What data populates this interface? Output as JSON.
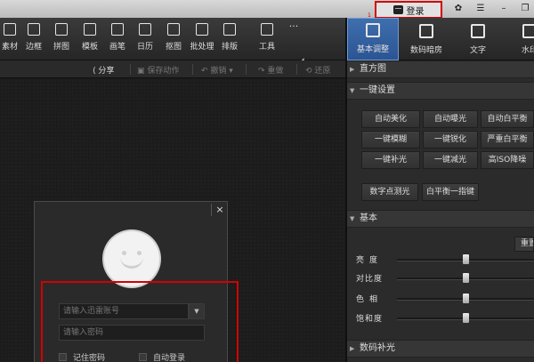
{
  "titlebar": {
    "login_label": "登录",
    "marker": "1"
  },
  "toolbar": {
    "tools": [
      "素材",
      "边框",
      "拼图",
      "模板",
      "画笔",
      "日历",
      "抠图",
      "批处理",
      "排版",
      "工具"
    ],
    "more": "···"
  },
  "right_tabs": [
    "基本调整",
    "数码暗房",
    "文字",
    "水印"
  ],
  "actionbar": {
    "share": "分享",
    "save_action": "保存动作",
    "undo": "撤销",
    "redo": "重做",
    "restore": "还原"
  },
  "panel": {
    "sections": {
      "histogram": "直方图",
      "one_click": "一键设置",
      "basic": "基本",
      "digital_fill": "数码补光"
    },
    "one_click_buttons": [
      "自动美化",
      "自动曝光",
      "自动白平衡",
      "一键模糊",
      "一键锐化",
      "严重白平衡",
      "一键补光",
      "一键减光",
      "高ISO降噪"
    ],
    "extra_buttons": [
      "数字点测光",
      "白平衡一指键"
    ],
    "reset": "重置",
    "sliders": [
      {
        "label": "亮度",
        "value": 0.5
      },
      {
        "label": "对比度",
        "value": 0.5
      },
      {
        "label": "色相",
        "value": 0.5
      },
      {
        "label": "饱和度",
        "value": 0.5
      }
    ]
  },
  "dialog": {
    "close": "×",
    "account_placeholder": "请输入迅雷账号",
    "password_placeholder": "请输入密码",
    "remember_password": "记住密码",
    "auto_login": "自动登录"
  }
}
